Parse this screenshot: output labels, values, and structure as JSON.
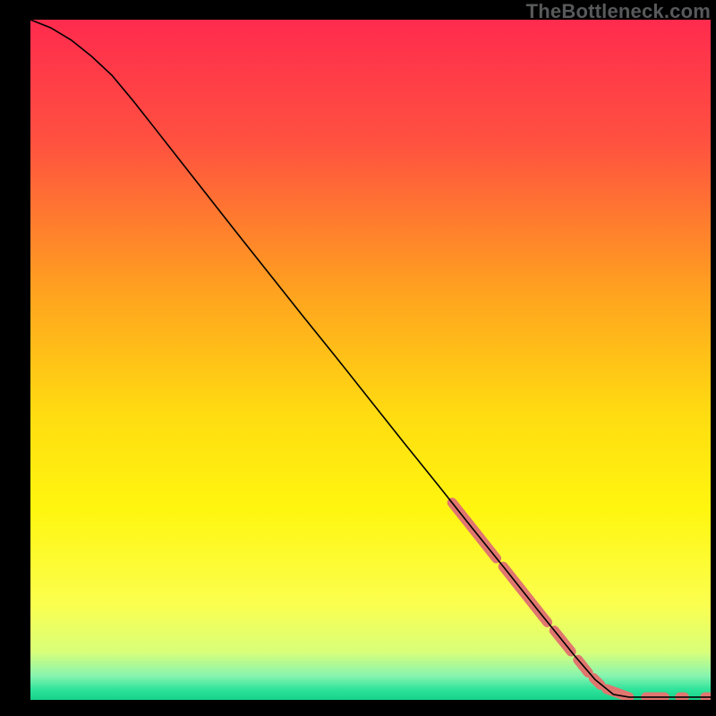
{
  "watermark": "TheBottleneck.com",
  "chart_data": {
    "type": "line",
    "title": "",
    "xlabel": "",
    "ylabel": "",
    "xlim": [
      0,
      100
    ],
    "ylim": [
      0,
      100
    ],
    "grid": false,
    "legend": false,
    "gradient_stops": [
      {
        "offset": 0.0,
        "color": "#ff2b4e"
      },
      {
        "offset": 0.18,
        "color": "#ff5140"
      },
      {
        "offset": 0.4,
        "color": "#ffa21f"
      },
      {
        "offset": 0.58,
        "color": "#ffdc11"
      },
      {
        "offset": 0.72,
        "color": "#fff60f"
      },
      {
        "offset": 0.86,
        "color": "#fbff4f"
      },
      {
        "offset": 0.93,
        "color": "#d8ff7a"
      },
      {
        "offset": 0.965,
        "color": "#86f4b0"
      },
      {
        "offset": 0.985,
        "color": "#2de39a"
      },
      {
        "offset": 1.0,
        "color": "#17d18a"
      }
    ],
    "series": [
      {
        "name": "curve",
        "type": "line",
        "stroke": "#000000",
        "stroke_width": 1.6,
        "points": [
          {
            "x": 0.0,
            "y": 100.0
          },
          {
            "x": 3.0,
            "y": 98.8
          },
          {
            "x": 6.0,
            "y": 97.0
          },
          {
            "x": 9.0,
            "y": 94.6
          },
          {
            "x": 12.0,
            "y": 91.8
          },
          {
            "x": 15.0,
            "y": 88.2
          },
          {
            "x": 18.0,
            "y": 84.4
          },
          {
            "x": 22.0,
            "y": 79.3
          },
          {
            "x": 26.0,
            "y": 74.2
          },
          {
            "x": 30.0,
            "y": 69.1
          },
          {
            "x": 35.0,
            "y": 62.8
          },
          {
            "x": 40.0,
            "y": 56.5
          },
          {
            "x": 45.0,
            "y": 50.3
          },
          {
            "x": 50.0,
            "y": 44.0
          },
          {
            "x": 55.0,
            "y": 37.7
          },
          {
            "x": 60.0,
            "y": 31.5
          },
          {
            "x": 65.0,
            "y": 25.2
          },
          {
            "x": 70.0,
            "y": 19.0
          },
          {
            "x": 75.0,
            "y": 12.7
          },
          {
            "x": 80.0,
            "y": 6.5
          },
          {
            "x": 83.0,
            "y": 3.0
          },
          {
            "x": 85.7,
            "y": 0.8
          },
          {
            "x": 88.0,
            "y": 0.4
          },
          {
            "x": 92.0,
            "y": 0.4
          },
          {
            "x": 96.0,
            "y": 0.4
          },
          {
            "x": 100.0,
            "y": 0.4
          }
        ]
      },
      {
        "name": "highlight-dots",
        "type": "scatter-segments",
        "color": "#e0766f",
        "stroke_width": 11,
        "segments": [
          {
            "x1": 62.0,
            "y1": 29.0,
            "x2": 68.5,
            "y2": 20.8
          },
          {
            "x1": 69.5,
            "y1": 19.6,
            "x2": 76.0,
            "y2": 11.4
          },
          {
            "x1": 77.0,
            "y1": 10.2,
            "x2": 79.5,
            "y2": 7.1
          },
          {
            "x1": 80.5,
            "y1": 5.9,
            "x2": 82.0,
            "y2": 4.0
          },
          {
            "x1": 82.8,
            "y1": 3.2,
            "x2": 83.8,
            "y2": 2.2
          },
          {
            "x1": 84.7,
            "y1": 1.6,
            "x2": 88.0,
            "y2": 0.4
          },
          {
            "x1": 90.5,
            "y1": 0.4,
            "x2": 93.2,
            "y2": 0.4
          },
          {
            "x1": 95.5,
            "y1": 0.4,
            "x2": 96.1,
            "y2": 0.4
          },
          {
            "x1": 99.2,
            "y1": 0.4,
            "x2": 99.8,
            "y2": 0.4
          }
        ]
      }
    ]
  }
}
